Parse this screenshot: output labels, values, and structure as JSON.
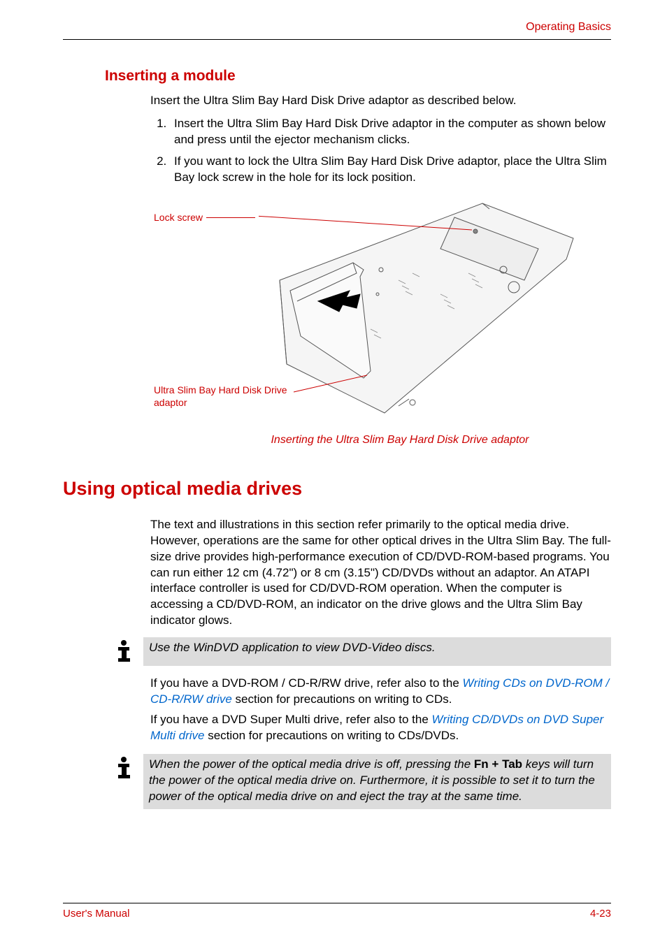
{
  "header": {
    "section_name": "Operating Basics"
  },
  "subsection": {
    "heading": "Inserting a module",
    "intro": "Insert the Ultra Slim Bay Hard Disk Drive adaptor as described below.",
    "steps": [
      "Insert the Ultra Slim Bay Hard Disk Drive adaptor in the computer as shown below and press until the ejector mechanism clicks.",
      "If you want to lock the Ultra Slim Bay Hard Disk Drive adaptor, place the Ultra Slim Bay lock screw in the hole for its lock position."
    ]
  },
  "figure": {
    "label1": "Lock screw",
    "label2": "Ultra Slim Bay Hard Disk Drive adaptor",
    "caption": "Inserting the Ultra Slim Bay Hard Disk Drive adaptor"
  },
  "section": {
    "heading": "Using optical media drives",
    "body": "The text and illustrations in this section refer primarily to the optical media drive. However, operations are the same for other optical drives in the Ultra Slim Bay. The full-size drive provides high-performance execution of CD/DVD-ROM-based programs. You can run either 12 cm (4.72\") or 8 cm (3.15\") CD/DVDs without an adaptor. An ATAPI interface controller is used for CD/DVD-ROM operation. When the computer is accessing a CD/DVD-ROM, an indicator on the drive glows and the Ultra Slim Bay indicator glows."
  },
  "note1": {
    "text": "Use the WinDVD application to view DVD-Video discs."
  },
  "refs": {
    "p1_pre": "If you have a DVD-ROM / CD-R/RW drive, refer also to the ",
    "p1_link": "Writing CDs on DVD-ROM / CD-R/RW drive",
    "p1_post": " section for precautions on writing to CDs.",
    "p2_pre": "If you have a DVD Super Multi drive, refer also to the ",
    "p2_link": "Writing CD/DVDs on DVD Super Multi drive",
    "p2_post": " section for precautions on writing to CDs/DVDs."
  },
  "note2": {
    "pre": "When the power of the optical media drive is off, pressing the ",
    "key1": "Fn",
    "plus": " + ",
    "key2": "Tab",
    "post": " keys will turn the power of the optical media drive on. Furthermore, it is possible to set it to turn the power of the optical media drive on and eject the tray at the same time."
  },
  "footer": {
    "left": "User's Manual",
    "right": "4-23"
  }
}
